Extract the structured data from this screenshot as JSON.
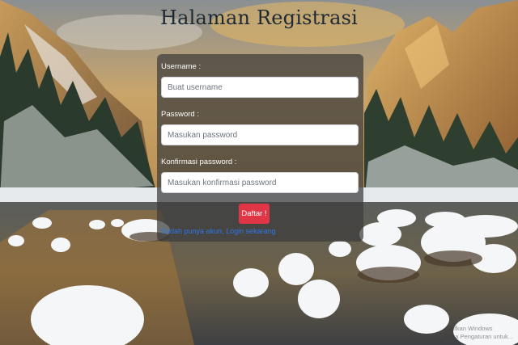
{
  "page": {
    "title": "Halaman Registrasi"
  },
  "form": {
    "username_label": "Username :",
    "username_placeholder": "Buat username",
    "password_label": "Password :",
    "password_placeholder": "Masukan password",
    "confirm_label": "Konfirmasi password :",
    "confirm_placeholder": "Masukan konfirmasi password",
    "submit_label": "Daftar !",
    "login_link": "Sudah punya akun, Login sekarang"
  },
  "watermark": {
    "line1": "Aktifkan Windows",
    "line2": "Buka Pengaturan untuk..."
  },
  "colors": {
    "card_overlay": "#3c3c3c",
    "submit_button": "#e03545",
    "link": "#2f76e6",
    "title": "#1e2a33"
  }
}
